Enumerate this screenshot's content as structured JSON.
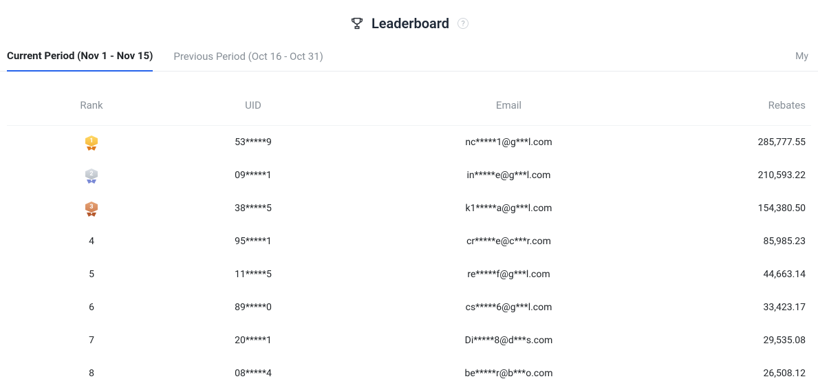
{
  "header": {
    "title": "Leaderboard"
  },
  "tabs": {
    "current": "Current Period (Nov 1 - Nov 15)",
    "previous": "Previous Period (Oct 16 - Oct 31)",
    "my": "My"
  },
  "columns": {
    "rank": "Rank",
    "uid": "UID",
    "email": "Email",
    "rebates": "Rebates"
  },
  "rows": [
    {
      "rank": 1,
      "medal": "gold",
      "uid": "53*****9",
      "email": "nc*****1@g***l.com",
      "rebates": "285,777.55"
    },
    {
      "rank": 2,
      "medal": "silver",
      "uid": "09*****1",
      "email": "in*****e@g***l.com",
      "rebates": "210,593.22"
    },
    {
      "rank": 3,
      "medal": "bronze",
      "uid": "38*****5",
      "email": "k1*****a@g***l.com",
      "rebates": "154,380.50"
    },
    {
      "rank": 4,
      "uid": "95*****1",
      "email": "cr*****e@c***r.com",
      "rebates": "85,985.23"
    },
    {
      "rank": 5,
      "uid": "11*****5",
      "email": "re*****f@g***l.com",
      "rebates": "44,663.14"
    },
    {
      "rank": 6,
      "uid": "89*****0",
      "email": "cs*****6@g***l.com",
      "rebates": "33,423.17"
    },
    {
      "rank": 7,
      "uid": "20*****1",
      "email": "Di*****8@d***s.com",
      "rebates": "29,535.08"
    },
    {
      "rank": 8,
      "uid": "08*****4",
      "email": "be*****r@b***o.com",
      "rebates": "26,508.12"
    }
  ]
}
